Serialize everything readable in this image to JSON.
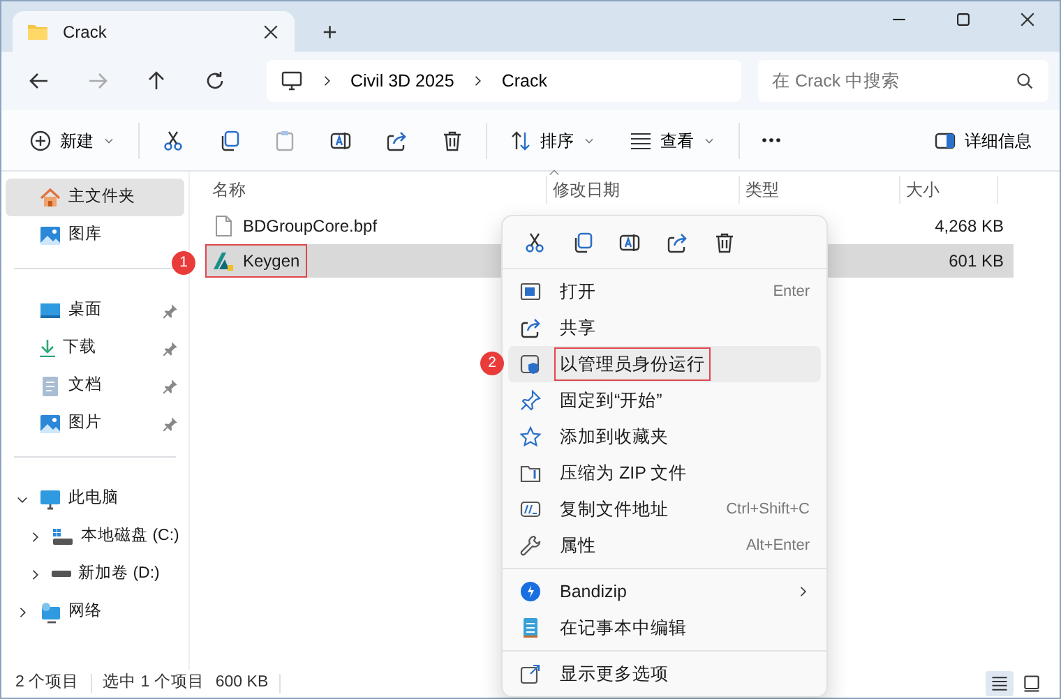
{
  "window": {
    "tabs": [
      {
        "title": "Crack",
        "selected": true
      }
    ],
    "new_tab": "+"
  },
  "address_bar": {
    "breadcrumbs": [
      "Civil 3D 2025",
      "Crack"
    ],
    "search": {
      "placeholder": "在 Crack 中搜索"
    }
  },
  "toolbar": {
    "items": [
      {
        "kind": "new",
        "label": "新建",
        "dropdown": true,
        "disabled": false
      },
      {
        "kind": "cut",
        "disabled": false
      },
      {
        "kind": "copy",
        "disabled": false
      },
      {
        "kind": "paste",
        "disabled": true
      },
      {
        "kind": "rename",
        "disabled": false
      },
      {
        "kind": "share",
        "disabled": false
      },
      {
        "kind": "delete",
        "disabled": false
      },
      {
        "kind": "sort",
        "label": "排序",
        "dropdown": true,
        "disabled": false
      },
      {
        "kind": "view",
        "label": "查看",
        "dropdown": true,
        "disabled": false
      },
      {
        "kind": "more",
        "disabled": false
      }
    ],
    "details": {
      "label": "详细信息"
    }
  },
  "sidebar": {
    "sections": [
      {
        "items": [
          {
            "label": "主文件夹",
            "kind": "home",
            "selected": true,
            "pinned": false
          },
          {
            "label": "图库",
            "kind": "gallery",
            "selected": false,
            "pinned": false
          }
        ]
      },
      {
        "items": [
          {
            "label": "桌面",
            "kind": "desktop",
            "selected": false,
            "pinned": true
          },
          {
            "label": "下载",
            "kind": "download",
            "selected": false,
            "pinned": true
          },
          {
            "label": "文档",
            "kind": "document",
            "selected": false,
            "pinned": true
          },
          {
            "label": "图片",
            "kind": "gallery",
            "selected": false,
            "pinned": true
          }
        ]
      },
      {
        "items": [
          {
            "label": "此电脑",
            "kind": "computer",
            "selected": false,
            "pinned": false,
            "expanded": true,
            "children": [
              {
                "label": "本地磁盘 (C:)",
                "kind": "sysdrive",
                "selected": false,
                "pinned": false,
                "expanded": false
              },
              {
                "label": "新加卷 (D:)",
                "kind": "drive",
                "selected": false,
                "pinned": false,
                "expanded": false
              }
            ]
          },
          {
            "label": "网络",
            "kind": "network",
            "selected": false,
            "pinned": false,
            "expanded": false
          }
        ]
      }
    ]
  },
  "file_list": {
    "columns": [
      "名称",
      "修改日期",
      "类型",
      "大小"
    ],
    "rows": [
      {
        "name": "BDGroupCore.bpf",
        "kind": "file",
        "size": "4,268 KB",
        "selected": false,
        "highlighted": false
      },
      {
        "name": "Keygen",
        "kind": "app",
        "size": "601 KB",
        "selected": true,
        "highlighted": true,
        "annotation": "1"
      }
    ]
  },
  "context_menu": {
    "actions": [
      {
        "kind": "cut"
      },
      {
        "kind": "copy"
      },
      {
        "kind": "rename"
      },
      {
        "kind": "share"
      },
      {
        "kind": "delete"
      }
    ],
    "sections": [
      {
        "items": [
          {
            "label": "打开",
            "kind": "open",
            "shortcut": "Enter",
            "selected": false,
            "highlighted": false,
            "submenu": false
          },
          {
            "label": "共享",
            "kind": "share",
            "selected": false,
            "highlighted": false,
            "submenu": false
          },
          {
            "label": "以管理员身份运行",
            "kind": "admin",
            "selected": true,
            "highlighted": true,
            "annotation": "2",
            "submenu": false
          },
          {
            "label": "固定到“开始”",
            "kind": "pin",
            "selected": false,
            "highlighted": false,
            "submenu": false
          },
          {
            "label": "添加到收藏夹",
            "kind": "star",
            "selected": false,
            "highlighted": false,
            "submenu": false
          },
          {
            "label": "压缩为 ZIP 文件",
            "kind": "zip",
            "selected": false,
            "highlighted": false,
            "submenu": false
          },
          {
            "label": "复制文件地址",
            "kind": "path",
            "shortcut": "Ctrl+Shift+C",
            "selected": false,
            "highlighted": false,
            "submenu": false
          },
          {
            "label": "属性",
            "kind": "wrench",
            "shortcut": "Alt+Enter",
            "selected": false,
            "highlighted": false,
            "submenu": false
          }
        ]
      },
      {
        "items": [
          {
            "label": "Bandizip",
            "kind": "bandizip",
            "selected": false,
            "highlighted": false,
            "submenu": true
          },
          {
            "label": "在记事本中编辑",
            "kind": "notepad",
            "selected": false,
            "highlighted": false,
            "submenu": false
          }
        ]
      },
      {
        "items": [
          {
            "label": "显示更多选项",
            "kind": "more",
            "selected": false,
            "highlighted": false,
            "submenu": false
          }
        ]
      }
    ]
  },
  "status_bar": {
    "count": "2 个项目",
    "selection": "选中 1 个项目",
    "size": "600 KB",
    "views": [
      {
        "kind": "details",
        "selected": true
      },
      {
        "kind": "tiles",
        "selected": false
      }
    ]
  }
}
